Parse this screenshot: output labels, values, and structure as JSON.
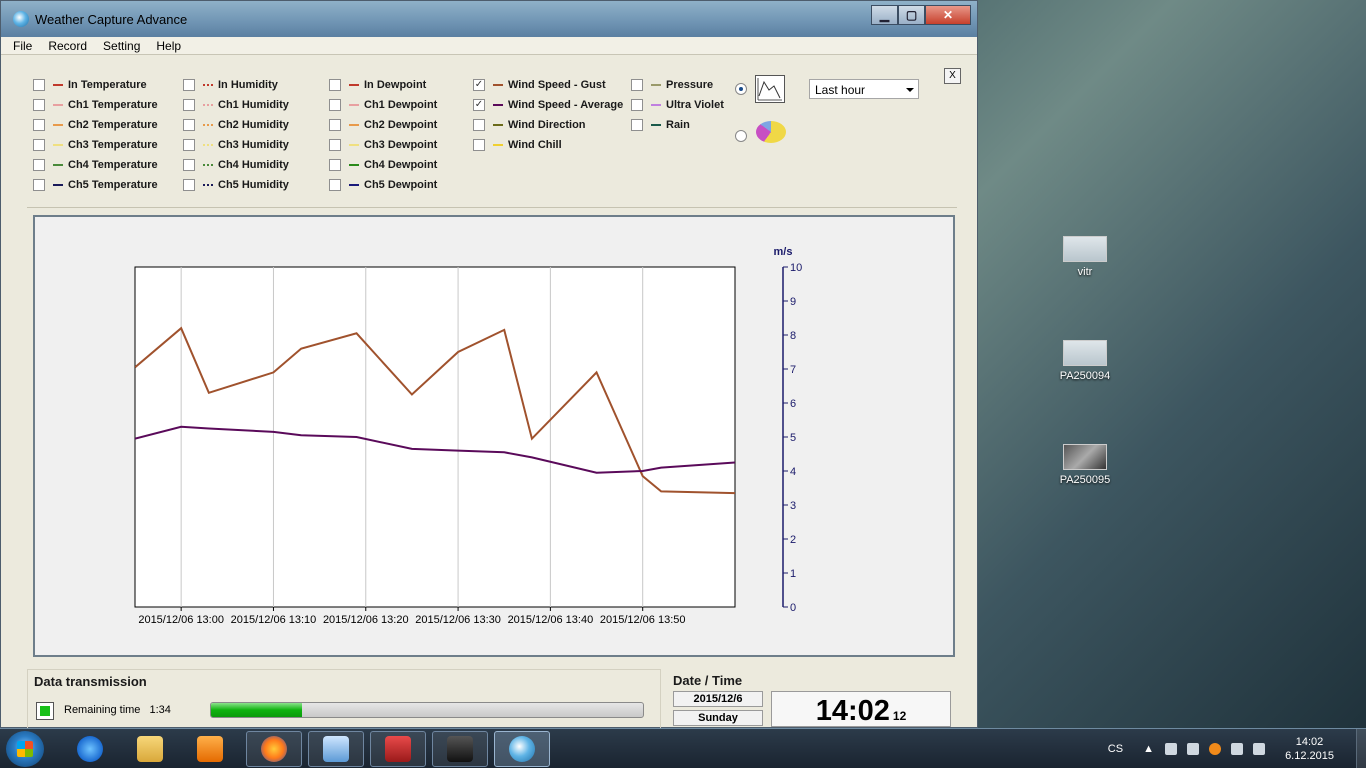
{
  "window": {
    "title": "Weather Capture Advance"
  },
  "menu": [
    "File",
    "Record",
    "Setting",
    "Help"
  ],
  "options": {
    "columns": [
      [
        {
          "label": "In Temperature",
          "checked": false,
          "color": "#c0392b",
          "style": "solid"
        },
        {
          "label": "Ch1 Temperature",
          "checked": false,
          "color": "#e8a0a0",
          "style": "solid"
        },
        {
          "label": "Ch2 Temperature",
          "checked": false,
          "color": "#e89a4a",
          "style": "solid"
        },
        {
          "label": "Ch3 Temperature",
          "checked": false,
          "color": "#f0e080",
          "style": "solid"
        },
        {
          "label": "Ch4 Temperature",
          "checked": false,
          "color": "#4a8a3a",
          "style": "solid"
        },
        {
          "label": "Ch5 Temperature",
          "checked": false,
          "color": "#1a1a5a",
          "style": "solid"
        }
      ],
      [
        {
          "label": "In Humidity",
          "checked": false,
          "color": "#c0392b",
          "style": "dot"
        },
        {
          "label": "Ch1 Humidity",
          "checked": false,
          "color": "#e8a0a0",
          "style": "dot"
        },
        {
          "label": "Ch2 Humidity",
          "checked": false,
          "color": "#e89a4a",
          "style": "dot"
        },
        {
          "label": "Ch3 Humidity",
          "checked": false,
          "color": "#f0e080",
          "style": "dot"
        },
        {
          "label": "Ch4 Humidity",
          "checked": false,
          "color": "#4a8a3a",
          "style": "dot"
        },
        {
          "label": "Ch5 Humidity",
          "checked": false,
          "color": "#1a1a5a",
          "style": "dot"
        }
      ],
      [
        {
          "label": "In Dewpoint",
          "checked": false,
          "color": "#c0392b",
          "style": "dash"
        },
        {
          "label": "Ch1 Dewpoint",
          "checked": false,
          "color": "#e8a0a0",
          "style": "dash"
        },
        {
          "label": "Ch2 Dewpoint",
          "checked": false,
          "color": "#e89a4a",
          "style": "dash"
        },
        {
          "label": "Ch3 Dewpoint",
          "checked": false,
          "color": "#f0e080",
          "style": "dash"
        },
        {
          "label": "Ch4 Dewpoint",
          "checked": false,
          "color": "#2a8a1a",
          "style": "dash"
        },
        {
          "label": "Ch5 Dewpoint",
          "checked": false,
          "color": "#1a1a7a",
          "style": "dash"
        }
      ],
      [
        {
          "label": "Wind Speed - Gust",
          "checked": true,
          "color": "#a0522d",
          "style": "solid"
        },
        {
          "label": "Wind Speed - Average",
          "checked": true,
          "color": "#5a0a5a",
          "style": "solid"
        },
        {
          "label": "Wind Direction",
          "checked": false,
          "color": "#6b6b1a",
          "style": "solid"
        },
        {
          "label": "Wind Chill",
          "checked": false,
          "color": "#f0d030",
          "style": "solid"
        }
      ],
      [
        {
          "label": "Pressure",
          "checked": false,
          "color": "#9a9a6a",
          "style": "solid"
        },
        {
          "label": "Ultra Violet",
          "checked": false,
          "color": "#c080e0",
          "style": "solid"
        },
        {
          "label": "Rain",
          "checked": false,
          "color": "#1a5a4a",
          "style": "solid"
        }
      ]
    ],
    "range_select": "Last hour",
    "close_label": "X"
  },
  "chart_data": {
    "type": "line",
    "ylabel": "m/s",
    "ylim": [
      0,
      10
    ],
    "yticks": [
      "0",
      "1",
      "2",
      "3",
      "4",
      "5",
      "6",
      "7",
      "8",
      "9",
      "10"
    ],
    "xticks": [
      "2015/12/06 13:00",
      "2015/12/06 13:10",
      "2015/12/06 13:20",
      "2015/12/06 13:30",
      "2015/12/06 13:40",
      "2015/12/06 13:50"
    ],
    "grid": true,
    "x_minutes": [
      -5,
      0,
      3,
      10,
      13,
      19,
      25,
      30,
      35,
      38,
      45,
      50,
      52,
      60
    ],
    "series": [
      {
        "name": "Wind Speed - Gust",
        "color": "#a0522d",
        "values": [
          7.05,
          8.2,
          6.3,
          6.9,
          7.6,
          8.05,
          6.25,
          7.5,
          8.15,
          4.95,
          6.9,
          3.85,
          3.4,
          3.35
        ]
      },
      {
        "name": "Wind Speed - Average",
        "color": "#5a0a5a",
        "values": [
          4.95,
          5.3,
          5.25,
          5.15,
          5.05,
          5.0,
          4.65,
          4.6,
          4.55,
          4.4,
          3.95,
          4.0,
          4.1,
          4.25
        ]
      }
    ]
  },
  "transmission": {
    "title": "Data transmission",
    "remaining_label": "Remaining time",
    "remaining_value": "1:34",
    "progress": 0.21
  },
  "datetime": {
    "title": "Date / Time",
    "date": "2015/12/6",
    "day": "Sunday",
    "time": "14:02",
    "seconds": "12"
  },
  "desktop": [
    {
      "label": "vitr"
    },
    {
      "label": "PA250094"
    },
    {
      "label": "PA250095"
    }
  ],
  "taskbar": {
    "lang": "CS",
    "clock_time": "14:02",
    "clock_date": "6.12.2015"
  }
}
